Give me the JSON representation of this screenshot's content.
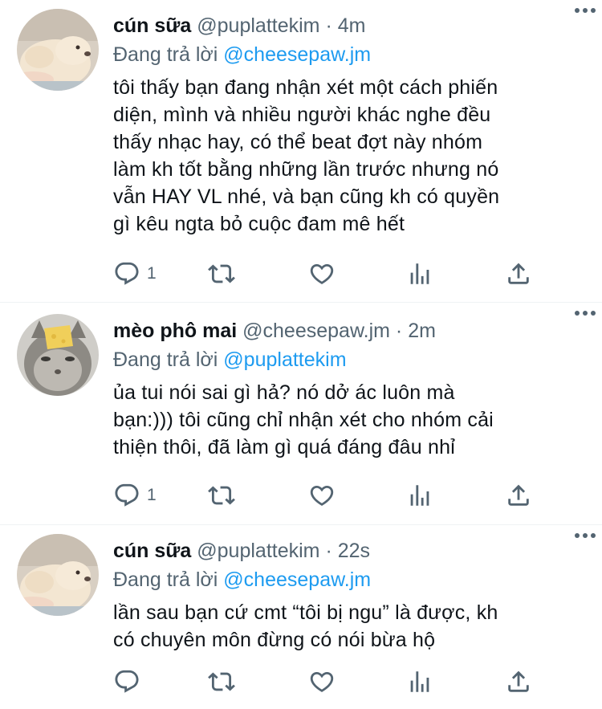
{
  "tweets": [
    {
      "name": "cún sữa",
      "handle": "@puplattekim",
      "separator": "·",
      "time": "4m",
      "reply_prefix": "Đang trả lời",
      "reply_to": "@cheesepaw.jm",
      "lines": [
        "tôi thấy bạn đang nhận xét một cách phiến",
        "diện, mình và nhiều người khác nghe đều",
        "thấy nhạc hay, có thể beat đợt này nhóm",
        "làm kh tốt bằng những lần trước nhưng nó",
        "vẫn HAY VL nhé, và bạn cũng kh có quyền",
        "gì kêu ngta bỏ cuộc đam mê hết"
      ],
      "reply_count": "1",
      "avatar_icon": "puppy-avatar-icon"
    },
    {
      "name": "mèo phô mai",
      "handle": "@cheesepaw.jm",
      "separator": "·",
      "time": "2m",
      "reply_prefix": "Đang trả lời",
      "reply_to": "@puplattekim",
      "lines": [
        "ủa tui nói sai gì hả? nó dở ác luôn mà",
        "bạn:))) tôi cũng chỉ nhận xét cho nhóm cải",
        "thiện thôi, đã làm gì quá đáng đâu nhỉ"
      ],
      "reply_count": "1",
      "avatar_icon": "cat-with-cheese-avatar-icon"
    },
    {
      "name": "cún sữa",
      "handle": "@puplattekim",
      "separator": "·",
      "time": "22s",
      "reply_prefix": "Đang trả lời",
      "reply_to": "@cheesepaw.jm",
      "lines": [
        "lần sau bạn cứ cmt “tôi bị ngu” là được, kh",
        "có chuyên môn đừng có nói bừa hộ"
      ],
      "reply_count": "",
      "avatar_icon": "puppy-avatar-icon"
    }
  ],
  "colors": {
    "text": "#0f1419",
    "secondary": "#536471",
    "accent": "#1d9bf0",
    "divider": "#eff3f4"
  }
}
